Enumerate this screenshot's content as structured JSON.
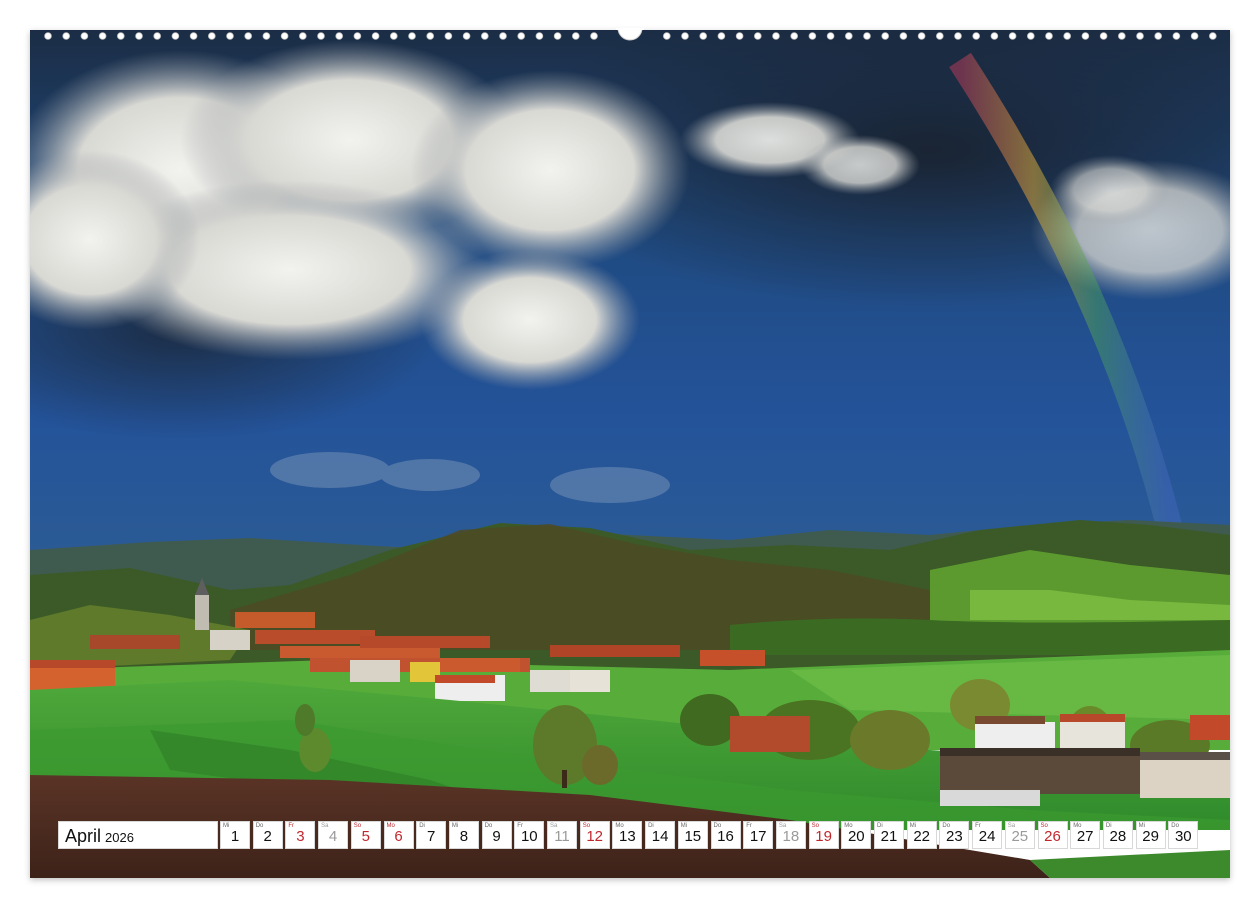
{
  "calendar": {
    "month": "April",
    "year": "2026",
    "days": [
      {
        "wd": "Mi",
        "n": "1",
        "t": "w"
      },
      {
        "wd": "Do",
        "n": "2",
        "t": "w"
      },
      {
        "wd": "Fr",
        "n": "3",
        "t": "hol"
      },
      {
        "wd": "Sa",
        "n": "4",
        "t": "sat"
      },
      {
        "wd": "So",
        "n": "5",
        "t": "sun"
      },
      {
        "wd": "Mo",
        "n": "6",
        "t": "hol"
      },
      {
        "wd": "Di",
        "n": "7",
        "t": "w"
      },
      {
        "wd": "Mi",
        "n": "8",
        "t": "w"
      },
      {
        "wd": "Do",
        "n": "9",
        "t": "w"
      },
      {
        "wd": "Fr",
        "n": "10",
        "t": "w"
      },
      {
        "wd": "Sa",
        "n": "11",
        "t": "sat"
      },
      {
        "wd": "So",
        "n": "12",
        "t": "sun"
      },
      {
        "wd": "Mo",
        "n": "13",
        "t": "w"
      },
      {
        "wd": "Di",
        "n": "14",
        "t": "w"
      },
      {
        "wd": "Mi",
        "n": "15",
        "t": "w"
      },
      {
        "wd": "Do",
        "n": "16",
        "t": "w"
      },
      {
        "wd": "Fr",
        "n": "17",
        "t": "w"
      },
      {
        "wd": "Sa",
        "n": "18",
        "t": "sat"
      },
      {
        "wd": "So",
        "n": "19",
        "t": "sun"
      },
      {
        "wd": "Mo",
        "n": "20",
        "t": "w"
      },
      {
        "wd": "Di",
        "n": "21",
        "t": "w"
      },
      {
        "wd": "Mi",
        "n": "22",
        "t": "w"
      },
      {
        "wd": "Do",
        "n": "23",
        "t": "w"
      },
      {
        "wd": "Fr",
        "n": "24",
        "t": "w"
      },
      {
        "wd": "Sa",
        "n": "25",
        "t": "sat"
      },
      {
        "wd": "So",
        "n": "26",
        "t": "sun"
      },
      {
        "wd": "Mo",
        "n": "27",
        "t": "w"
      },
      {
        "wd": "Di",
        "n": "28",
        "t": "w"
      },
      {
        "wd": "Mi",
        "n": "29",
        "t": "w"
      },
      {
        "wd": "Do",
        "n": "30",
        "t": "w"
      }
    ]
  },
  "colors": {
    "sunday_holiday": "#c0272d",
    "saturday": "#9a9a9a",
    "weekday": "#111111"
  },
  "photo": {
    "subject": "landscape-village-rainbow-photo"
  }
}
